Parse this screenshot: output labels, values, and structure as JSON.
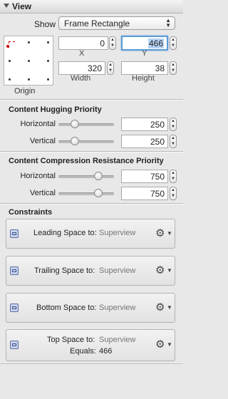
{
  "header": {
    "title": "View"
  },
  "show": {
    "label": "Show",
    "selected": "Frame Rectangle"
  },
  "origin": {
    "label": "Origin"
  },
  "frame": {
    "x": {
      "value": "0",
      "label": "X"
    },
    "y": {
      "value": "466",
      "label": "Y"
    },
    "width": {
      "value": "320",
      "label": "Width"
    },
    "height": {
      "value": "38",
      "label": "Height"
    }
  },
  "hugging": {
    "title": "Content Hugging Priority",
    "horizontal": {
      "label": "Horizontal",
      "value": "250",
      "level": 0.25
    },
    "vertical": {
      "label": "Vertical",
      "value": "250",
      "level": 0.25
    }
  },
  "compression": {
    "title": "Content Compression Resistance Priority",
    "horizontal": {
      "label": "Horizontal",
      "value": "750",
      "level": 0.75
    },
    "vertical": {
      "label": "Vertical",
      "value": "750",
      "level": 0.75
    }
  },
  "constraints": {
    "title": "Constraints",
    "items": [
      {
        "label": "Leading Space to:",
        "target": "Superview",
        "equals": ""
      },
      {
        "label": "Trailing Space to:",
        "target": "Superview",
        "equals": ""
      },
      {
        "label": "Bottom Space to:",
        "target": "Superview",
        "equals": ""
      },
      {
        "label": "Top Space to:",
        "target": "Superview",
        "equals": "Equals:",
        "equals_value": "466"
      }
    ]
  },
  "icons": {
    "disclosure": "disclosure-triangle-icon",
    "gear": "gear-icon",
    "constraint": "constraint-icon",
    "stepper": "stepper-icon"
  },
  "colors": {
    "focus": "#5b9bd5",
    "panel": "#e8e8e8",
    "origin_marker": "#cc0000"
  }
}
